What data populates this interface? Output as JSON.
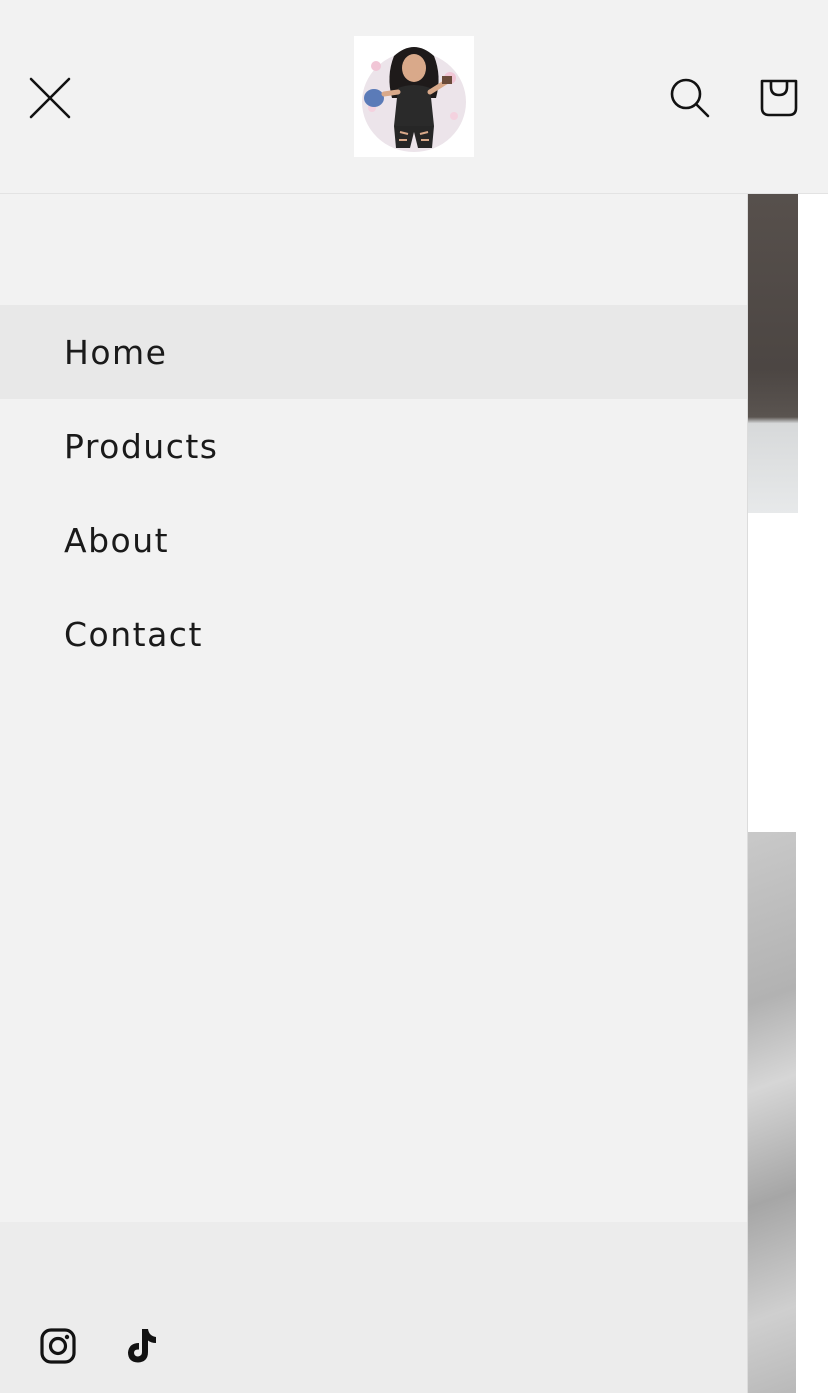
{
  "header": {
    "logo_alt": "Store logo"
  },
  "menu": {
    "items": [
      {
        "label": "Home",
        "active": true
      },
      {
        "label": "Products",
        "active": false
      },
      {
        "label": "About",
        "active": false
      },
      {
        "label": "Contact",
        "active": false
      }
    ]
  },
  "footer": {
    "social": [
      "instagram-icon",
      "tiktok-icon"
    ]
  },
  "colors": {
    "background": "#f2f2f2",
    "active_item": "#e8e8e8",
    "footer": "#ececec",
    "text": "#121212"
  }
}
